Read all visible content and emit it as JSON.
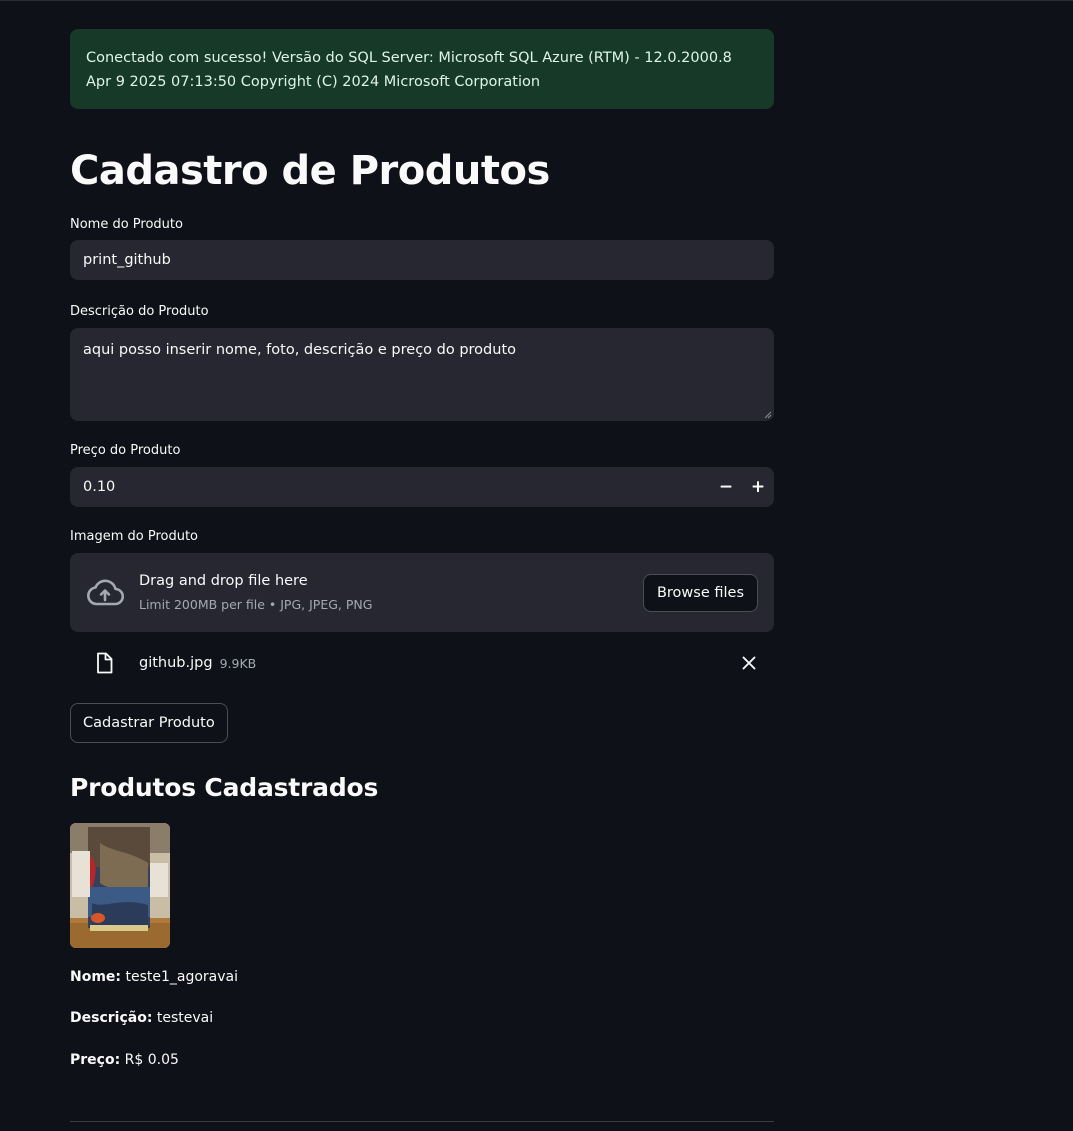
{
  "alert": {
    "message": "Conectado com sucesso! Versão do SQL Server: Microsoft SQL Azure (RTM) - 12.0.2000.8 Apr 9 2025 07:13:50 Copyright (C) 2024 Microsoft Corporation"
  },
  "page_title": "Cadastro de Produtos",
  "form": {
    "name_label": "Nome do Produto",
    "name_value": "print_github",
    "description_label": "Descrição do Produto",
    "description_value": "aqui posso inserir nome, foto, descrição e preço do produto",
    "price_label": "Preço do Produto",
    "price_value": "0.10",
    "decrement_symbol": "−",
    "increment_symbol": "+",
    "image_label": "Imagem do Produto",
    "uploader": {
      "title": "Drag and drop file here",
      "subtitle": "Limit 200MB per file • JPG, JPEG, PNG",
      "browse_label": "Browse files",
      "icon": "cloud-upload-icon"
    },
    "uploaded_file": {
      "name": "github.jpg",
      "size": "9.9KB",
      "icon": "file-icon",
      "remove_icon": "close-icon"
    },
    "submit_label": "Cadastrar Produto"
  },
  "products": {
    "heading": "Produtos Cadastrados",
    "items": [
      {
        "image_alt": "book-cover-thumbnail",
        "name_label": "Nome:",
        "name": "teste1_agoravai",
        "description_label": "Descrição:",
        "description": "testevai",
        "price_label": "Preço:",
        "price": "R$ 0.05"
      }
    ]
  },
  "colors": {
    "background": "#0e1117",
    "input_bg": "#262730",
    "alert_bg": "#173928",
    "alert_text": "#dff5e3"
  }
}
